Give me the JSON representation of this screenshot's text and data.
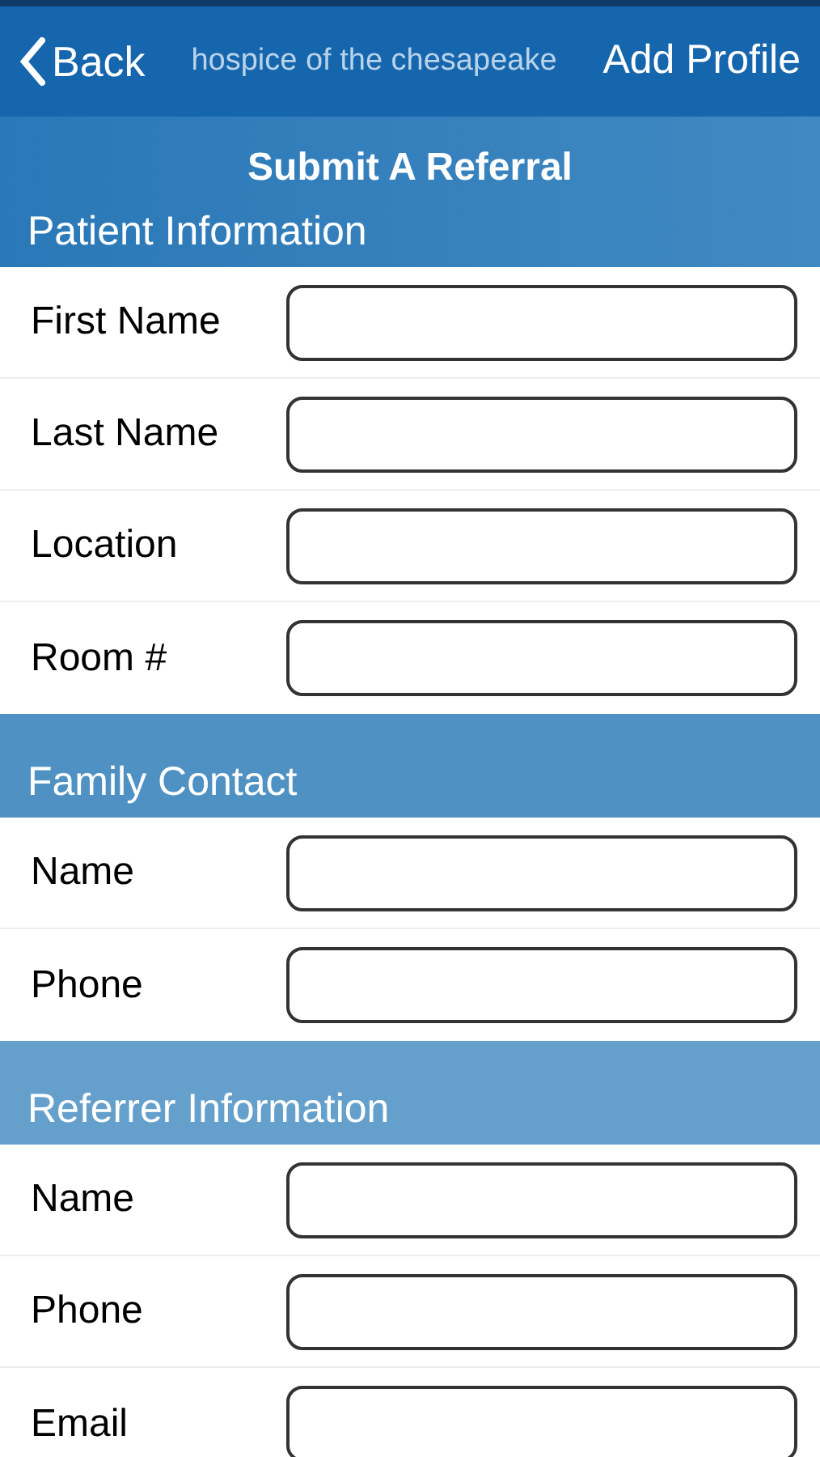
{
  "nav_bar": {
    "back": "Back",
    "brand": "hospice of the chesapeake",
    "action": "Add Profile"
  },
  "form_title": "Submit A Referral",
  "sections": [
    {
      "title": "Patient Information",
      "fields": [
        {
          "label": "First Name"
        },
        {
          "label": "Last Name"
        },
        {
          "label": "Location"
        },
        {
          "label": "Room #"
        }
      ]
    },
    {
      "title": "Family Contact",
      "fields": [
        {
          "label": "Name"
        },
        {
          "label": "Phone"
        }
      ]
    },
    {
      "title": "Referrer Information",
      "fields": [
        {
          "label": "Name"
        },
        {
          "label": "Phone"
        },
        {
          "label": "Email"
        }
      ]
    }
  ]
}
